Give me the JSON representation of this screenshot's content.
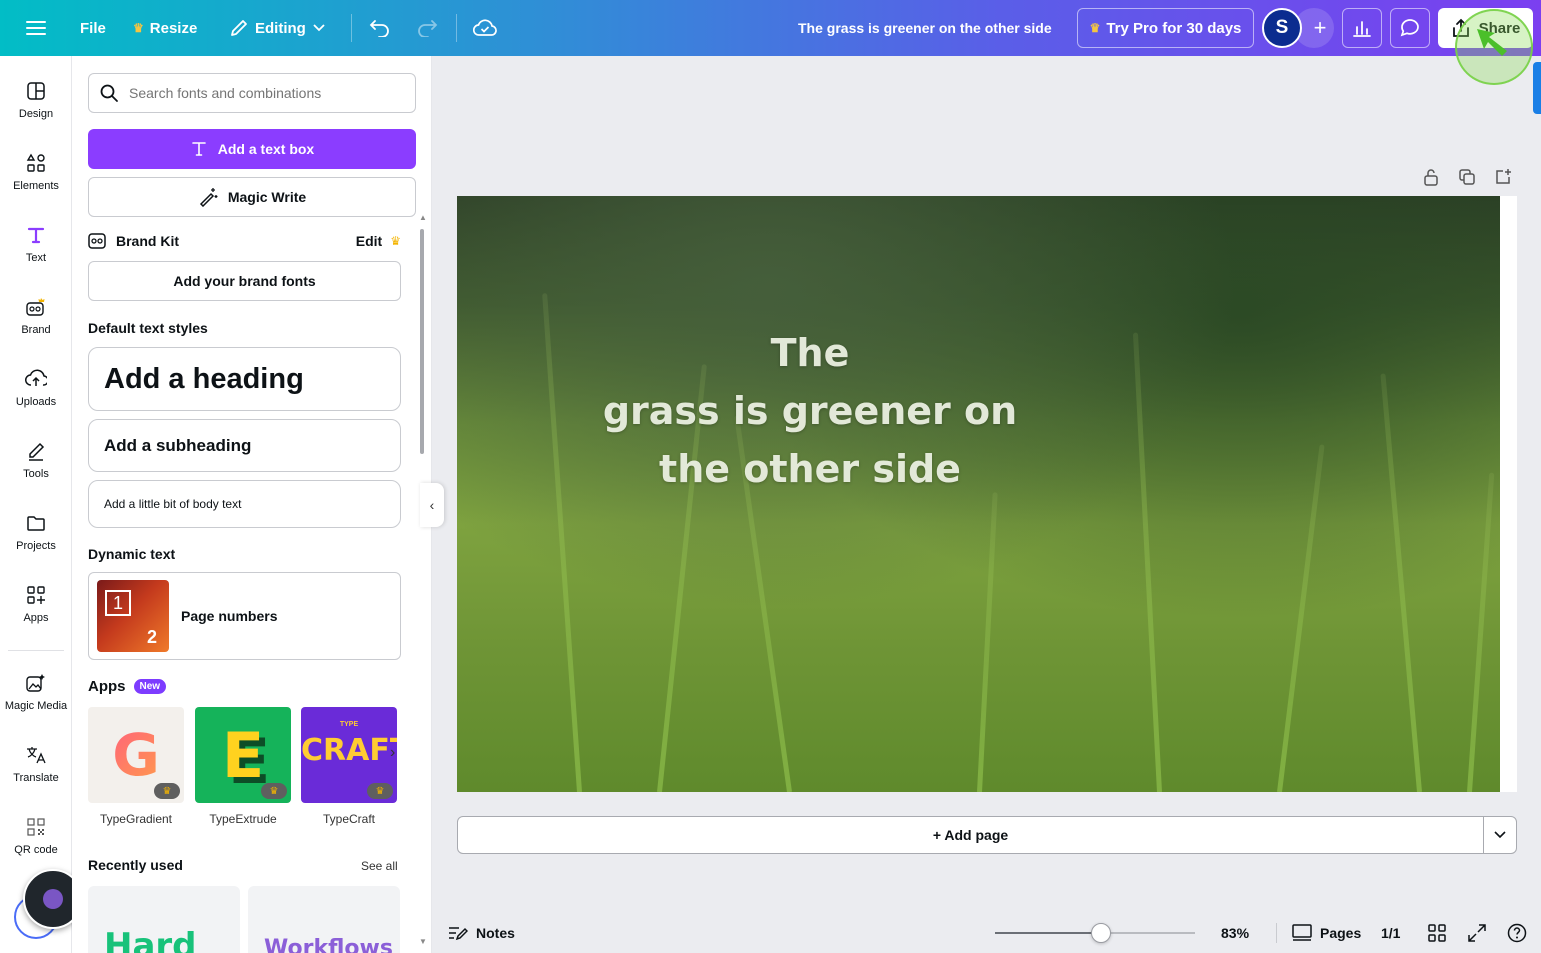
{
  "topbar": {
    "file_label": "File",
    "resize_label": "Resize",
    "editing_label": "Editing",
    "doc_title": "The grass is greener on the other side",
    "try_pro_label": "Try Pro for 30 days",
    "avatar_initial": "S",
    "share_label": "Share"
  },
  "rail": {
    "items": [
      {
        "label": "Design",
        "icon": "design-icon"
      },
      {
        "label": "Elements",
        "icon": "elements-icon"
      },
      {
        "label": "Text",
        "icon": "text-icon"
      },
      {
        "label": "Brand",
        "icon": "brand-icon"
      },
      {
        "label": "Uploads",
        "icon": "uploads-icon"
      },
      {
        "label": "Tools",
        "icon": "tools-icon"
      },
      {
        "label": "Projects",
        "icon": "projects-icon"
      },
      {
        "label": "Apps",
        "icon": "apps-icon"
      },
      {
        "label": "Magic Media",
        "icon": "magic-media-icon"
      },
      {
        "label": "Translate",
        "icon": "translate-icon"
      },
      {
        "label": "QR code",
        "icon": "qr-code-icon"
      }
    ],
    "active": "Text"
  },
  "panel": {
    "search_placeholder": "Search fonts and combinations",
    "add_text_box": "Add a text box",
    "magic_write": "Magic Write",
    "brand_kit": "Brand Kit",
    "brand_kit_edit": "Edit",
    "add_brand_fonts": "Add your brand fonts",
    "default_styles_heading": "Default text styles",
    "heading_sample": "Add a heading",
    "subheading_sample": "Add a subheading",
    "body_sample": "Add a little bit of body text",
    "dynamic_heading": "Dynamic text",
    "page_numbers": "Page numbers",
    "page_num_thumb_1": "1",
    "page_num_thumb_2": "2",
    "apps_heading": "Apps",
    "new_badge": "New",
    "apps": [
      {
        "name": "TypeGradient",
        "glyph": "G"
      },
      {
        "name": "TypeExtrude",
        "glyph": "E"
      },
      {
        "name": "TypeCraft",
        "glyph": "CRAFT",
        "small": "TYPE"
      }
    ],
    "recently_used": "Recently used",
    "see_all": "See all",
    "recent_cards": [
      "Hard",
      "Workflows"
    ]
  },
  "canvas": {
    "headline_lines": [
      "The",
      "grass is greener on",
      "the other side"
    ],
    "add_page": "+ Add page"
  },
  "bottombar": {
    "notes": "Notes",
    "zoom": "83%",
    "zoom_fraction": 0.53,
    "pages": "Pages",
    "page_count": "1/1"
  },
  "colors": {
    "accent": "#8b3dff",
    "avatar_bg": "#0b2c8f",
    "crown": "#f4b400"
  }
}
